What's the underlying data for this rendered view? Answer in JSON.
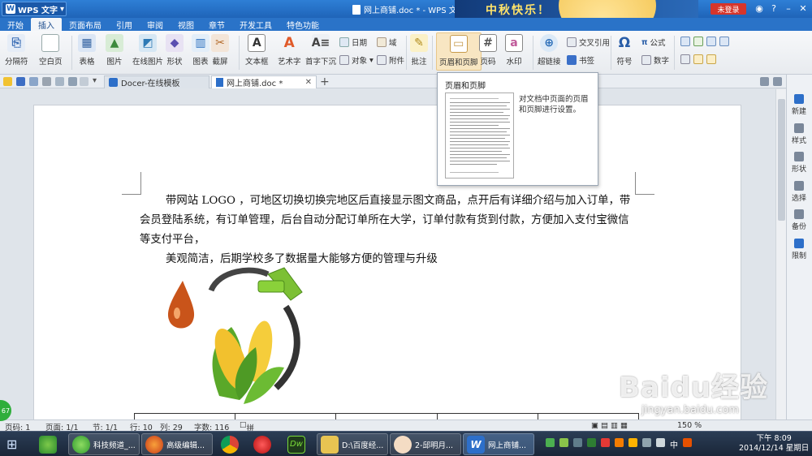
{
  "titlebar": {
    "app_button": "WPS 文字",
    "doc_title": "网上商铺.doc * - WPS 文字",
    "greeting": "中秋快乐！",
    "login": "未登录"
  },
  "tabs": [
    "开始",
    "插入",
    "页面布局",
    "引用",
    "审阅",
    "视图",
    "章节",
    "开发工具",
    "特色功能"
  ],
  "active_tab": "插入",
  "ribbon": {
    "section_break": "分隔符",
    "blank_page": "空白页",
    "table": "表格",
    "picture": "图片",
    "online_picture": "在线图片",
    "shape": "形状",
    "chart": "图表",
    "screenshot": "截屏",
    "textbox": "文本框",
    "wordart": "艺术字",
    "dropcap": "首字下沉",
    "date": "日期",
    "field": "域",
    "object": "对象",
    "attachment": "附件",
    "comment": "批注",
    "header_footer": "页眉和页脚",
    "page_number": "页码",
    "watermark": "水印",
    "hyperlink": "超链接",
    "cross_reference": "交叉引用",
    "bookmark": "书签",
    "symbol": "符号",
    "formula": "公式",
    "number": "数字"
  },
  "doc_tabs": [
    {
      "label": "Docer-在线模板"
    },
    {
      "label": "网上商铺.doc *"
    }
  ],
  "tooltip": {
    "title": "页眉和页脚",
    "description": "对文档中页面的页眉和页脚进行设置。"
  },
  "document": {
    "para1": "带网站 LOGO ，可地区切换切换完地区后直接显示图文商品，点开后有详细介绍与加入订单，带会员登陆系统，有订单管理，后台自动分配订单所在大学，订单付款有货到付款，方便加入支付宝微信等支付平台，",
    "para2": "美观简洁，后期学校多了数据量大能够方便的管理与升级"
  },
  "right_panel": [
    "新建",
    "样式",
    "形状",
    "选择",
    "备份",
    "限制"
  ],
  "status": {
    "page_num": "页码: 1",
    "pages": "页面: 1/1",
    "section": "节: 1/1",
    "row": "行: 10",
    "col": "列: 29",
    "words": "字数: 116",
    "spellcheck": "拼写检查",
    "zoom": "150 %"
  },
  "taskbar": {
    "items": [
      "科技频道_...",
      "高级编辑...",
      "D:\\百度经...",
      "2-邱明月...",
      "网上商铺..."
    ],
    "clock_time": "下午 8:09",
    "clock_date": "2014/12/14 星期日",
    "ime": "中"
  },
  "watermark": {
    "brand": "Baidu经验",
    "url": "jingyan.baidu.com"
  },
  "badge": "67"
}
